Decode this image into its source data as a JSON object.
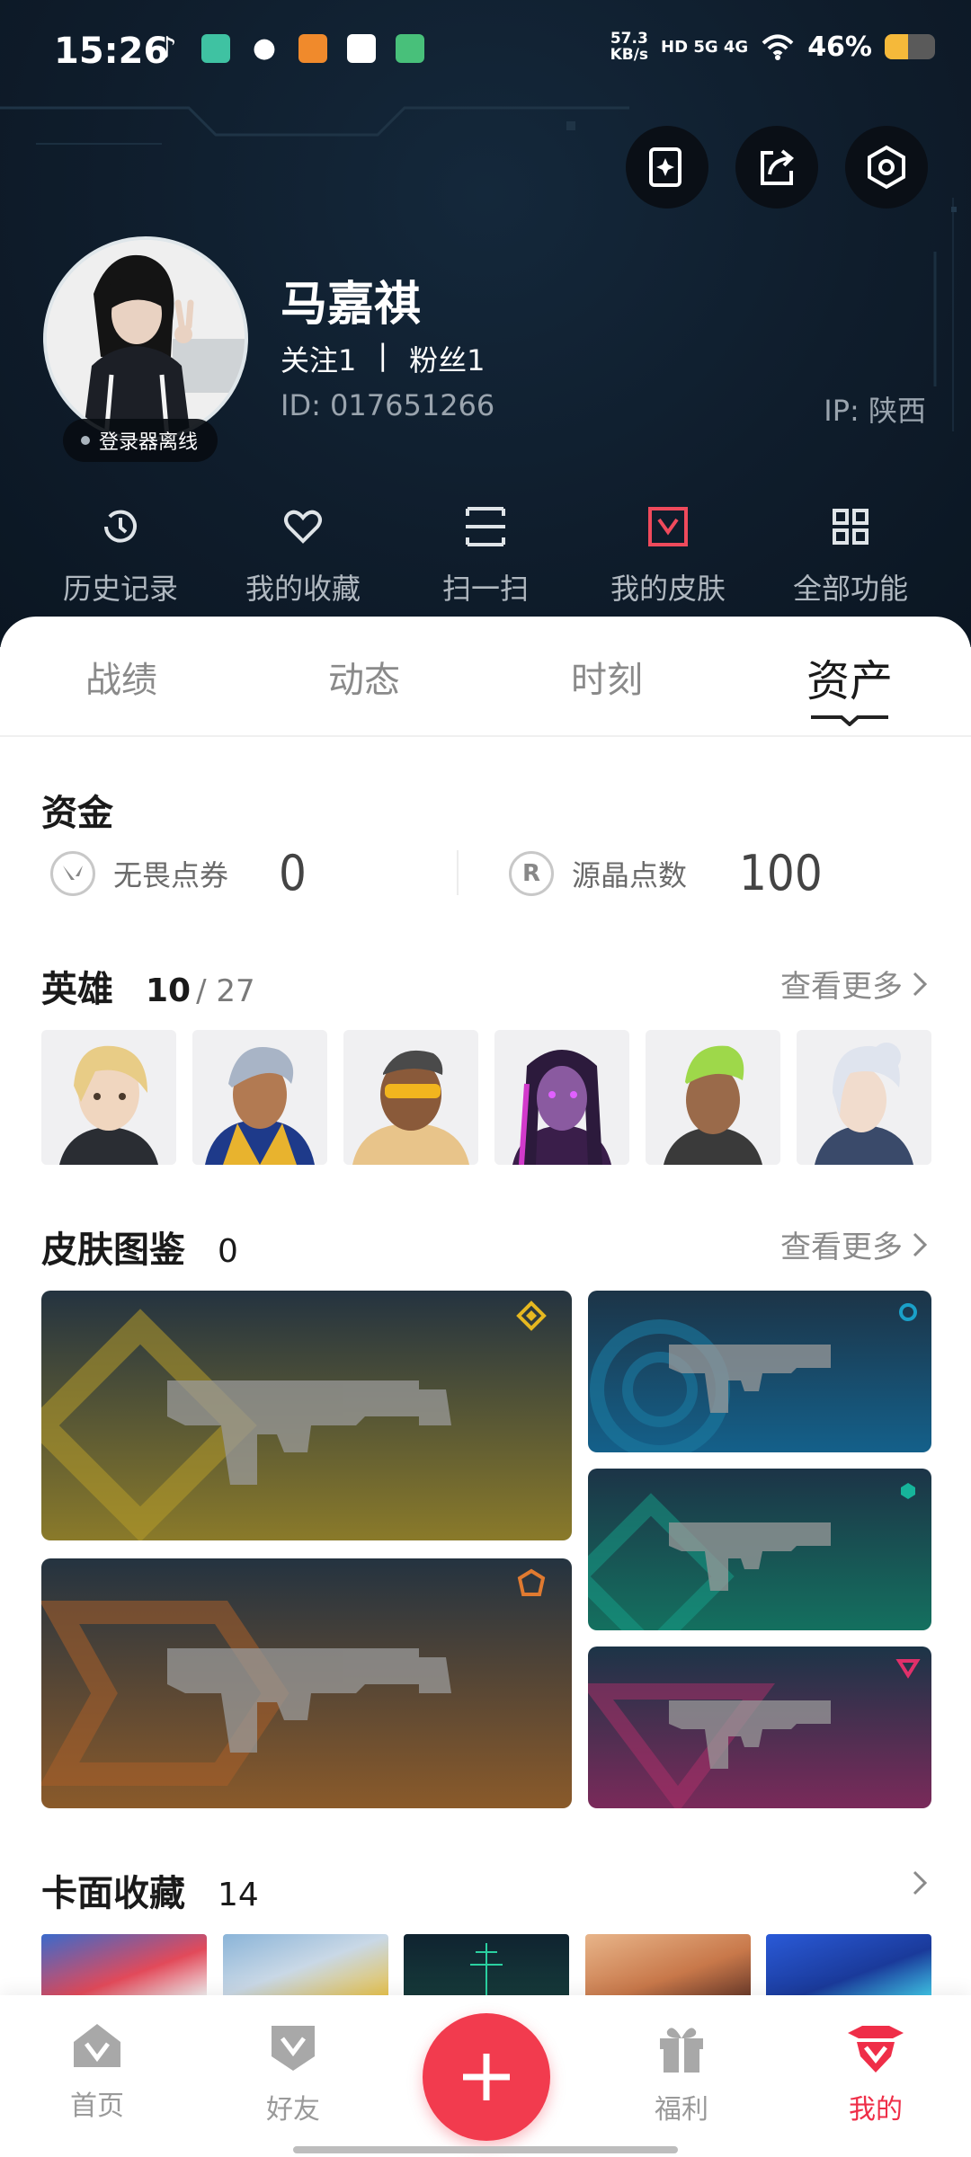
{
  "status_bar": {
    "time": "15:26",
    "net_speed": "57.3",
    "net_unit": "KB/s",
    "network": "HD 5G 4G",
    "battery": "46%"
  },
  "profile": {
    "name": "马嘉祺",
    "follow": "关注1",
    "separator": "|",
    "fans": "粉丝1",
    "id": "ID: 017651266",
    "ip": "IP: 陕西",
    "launcher_status": "登录器离线"
  },
  "quick_actions": [
    {
      "label": "历史记录",
      "icon": "history-icon"
    },
    {
      "label": "我的收藏",
      "icon": "heart-icon"
    },
    {
      "label": "扫一扫",
      "icon": "scan-icon"
    },
    {
      "label": "我的皮肤",
      "icon": "skin-icon"
    },
    {
      "label": "全部功能",
      "icon": "grid-icon"
    }
  ],
  "tabs": [
    "战绩",
    "动态",
    "时刻",
    "资产"
  ],
  "active_tab": "资产",
  "funds": {
    "title": "资金",
    "items": [
      {
        "label": "无畏点券",
        "value": "0",
        "icon": "valorant-points-icon"
      },
      {
        "label": "源晶点数",
        "value": "100",
        "icon": "radianite-icon",
        "icon_text": "R"
      }
    ]
  },
  "heroes": {
    "title": "英雄",
    "owned": "10",
    "total": "/ 27",
    "more": "查看更多"
  },
  "skins": {
    "title": "皮肤图鉴",
    "count": "0",
    "more": "查看更多"
  },
  "cards": {
    "title": "卡面收藏",
    "count": "14"
  },
  "bottom_nav": [
    {
      "label": "首页",
      "icon": "home-icon"
    },
    {
      "label": "好友",
      "icon": "friends-icon"
    },
    {
      "label": "",
      "icon": "plus-icon"
    },
    {
      "label": "福利",
      "icon": "gift-icon"
    },
    {
      "label": "我的",
      "icon": "profile-icon"
    }
  ],
  "colors": {
    "accent": "#f23b4e",
    "header_bg": "#0f1d2c",
    "skin_gold": "#e6b820",
    "skin_blue": "#1aa0c8",
    "skin_green": "#16b49a",
    "skin_orange": "#e07a30",
    "skin_pink": "#e0306a"
  }
}
